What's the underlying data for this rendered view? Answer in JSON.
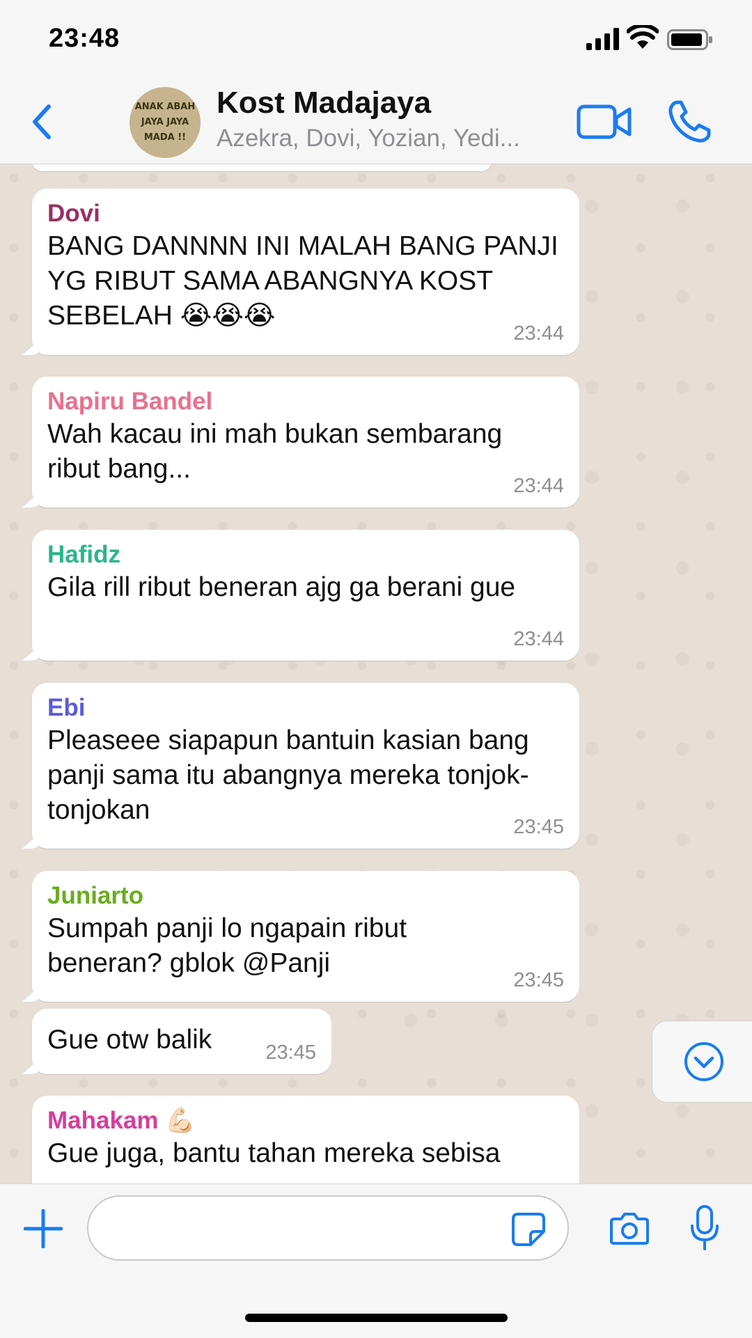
{
  "status_bar": {
    "time": "23:48"
  },
  "header": {
    "avatar_text": [
      "ANAK ABAH",
      "JAYA JAYA",
      "MADA !!"
    ],
    "title": "Kost Madajaya",
    "subtitle": "Azekra, Dovi, Yozian, Yedi..."
  },
  "colors": {
    "accent": "#1a7cf0",
    "chat_bg": "#e7ded5",
    "bubble": "#ffffff"
  },
  "messages": [
    {
      "sender": "Dovi",
      "sender_color": "#9a2f63",
      "text": "BANG DANNNN INI MALAH BANG PANJI YG RIBUT SAMA ABANGNYA KOST SEBELAH",
      "emoji": "😭😭😭",
      "time": "23:44"
    },
    {
      "sender": "Napiru Bandel",
      "sender_color": "#e8718e",
      "text": "Wah kacau ini mah bukan sembarang ribut bang...",
      "time": "23:44"
    },
    {
      "sender": "Hafidz",
      "sender_color": "#2ab68a",
      "text": "Gila rill ribut beneran ajg ga berani gue",
      "time": "23:44"
    },
    {
      "sender": "Ebi",
      "sender_color": "#5b5bd6",
      "text": "Pleaseee siapapun bantuin kasian bang panji sama itu abangnya mereka tonjok-tonjokan",
      "time": "23:45"
    },
    {
      "sender": "Juniarto",
      "sender_color": "#6aad1f",
      "text": "Sumpah panji lo ngapain ribut beneran? gblok @Panji",
      "time": "23:45"
    },
    {
      "sender": "",
      "text": "Gue otw balik",
      "time": "23:45"
    },
    {
      "sender": "Mahakam",
      "sender_color": "#d63d9a",
      "sender_emoji": "💪🏻",
      "text": "Gue juga, bantu tahan mereka sebisa",
      "time": ""
    }
  ],
  "input": {
    "placeholder": ""
  },
  "icons": [
    "back-chevron-icon",
    "video-call-icon",
    "phone-icon",
    "scroll-down-icon",
    "plus-icon",
    "sticker-icon",
    "camera-icon",
    "microphone-icon"
  ]
}
